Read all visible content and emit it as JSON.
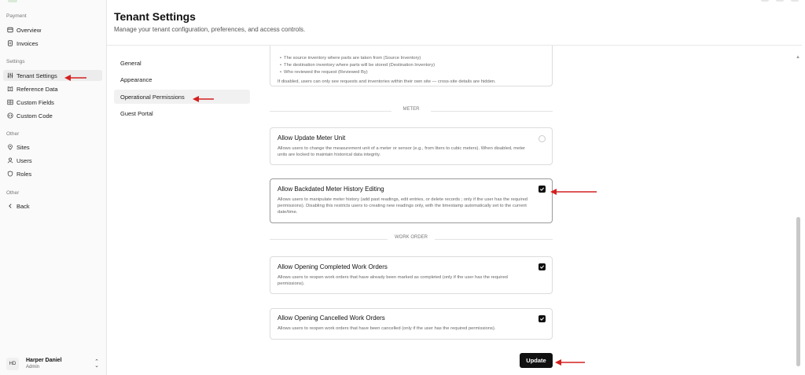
{
  "sidebar": {
    "sections": [
      {
        "label": "Payment",
        "items": [
          {
            "label": "Overview",
            "icon": "overview-icon"
          },
          {
            "label": "Invoices",
            "icon": "invoice-icon"
          }
        ]
      },
      {
        "label": "Settings",
        "items": [
          {
            "label": "Tenant Settings",
            "icon": "sliders-icon",
            "active": true
          },
          {
            "label": "Reference Data",
            "icon": "book-icon"
          },
          {
            "label": "Custom Fields",
            "icon": "grid-icon"
          },
          {
            "label": "Custom Code",
            "icon": "code-icon"
          }
        ]
      },
      {
        "label": "Other",
        "items": [
          {
            "label": "Sites",
            "icon": "location-pin-icon"
          },
          {
            "label": "Users",
            "icon": "user-icon"
          },
          {
            "label": "Roles",
            "icon": "shield-icon"
          }
        ]
      },
      {
        "label": "Other",
        "items": [
          {
            "label": "Back",
            "icon": "chevron-left-icon"
          }
        ]
      }
    ],
    "user": {
      "initials": "HD",
      "name": "Harper Daniel",
      "role": "Admin"
    }
  },
  "header": {
    "title": "Tenant Settings",
    "subtitle": "Manage your tenant configuration, preferences, and access controls."
  },
  "subnav": {
    "items": [
      {
        "label": "General"
      },
      {
        "label": "Appearance"
      },
      {
        "label": "Operational Permissions",
        "active": true
      },
      {
        "label": "Guest Portal"
      }
    ]
  },
  "content": {
    "top_card": {
      "bullets": [
        "The source inventory where parts are taken from (Source Inventory)",
        "The destination inventory where parts will be stored (Destination Inventory)",
        "Who reviewed the request (Reviewed By)"
      ],
      "note": "If disabled, users can only see requests and inventories within their own site — cross-site details are hidden."
    },
    "sections": {
      "meter": "METER",
      "work_order": "WORK ORDER"
    },
    "cards": {
      "update_meter_unit": {
        "title": "Allow Update Meter Unit",
        "description": "Allows users to change the measurement unit of a meter or sensor (e.g., from liters to cubic meters). When disabled, meter units are locked to maintain historical data integrity.",
        "checked": false
      },
      "backdated_meter": {
        "title": "Allow Backdated Meter History Editing",
        "description": "Allows users to manipulate meter history (add past readings, edit entries, or delete records ; only if the user has the required permissions). Disabling this restricts users to creating new readings only, with the timestamp automatically set to the current date/time.",
        "checked": true
      },
      "open_completed": {
        "title": "Allow Opening Completed Work Orders",
        "description": "Allows users to reopen work orders that have already been marked as completed (only if the user has the required permissions).",
        "checked": true
      },
      "open_cancelled": {
        "title": "Allow Opening Cancelled Work Orders",
        "description": "Allows users to reopen work orders that have been cancelled (only if the user has the required permissions).",
        "checked": true
      }
    },
    "update_label": "Update"
  },
  "colors": {
    "annotation_arrow": "#d42020",
    "primary_button": "#111111",
    "active_nav_bg": "#ececec"
  }
}
